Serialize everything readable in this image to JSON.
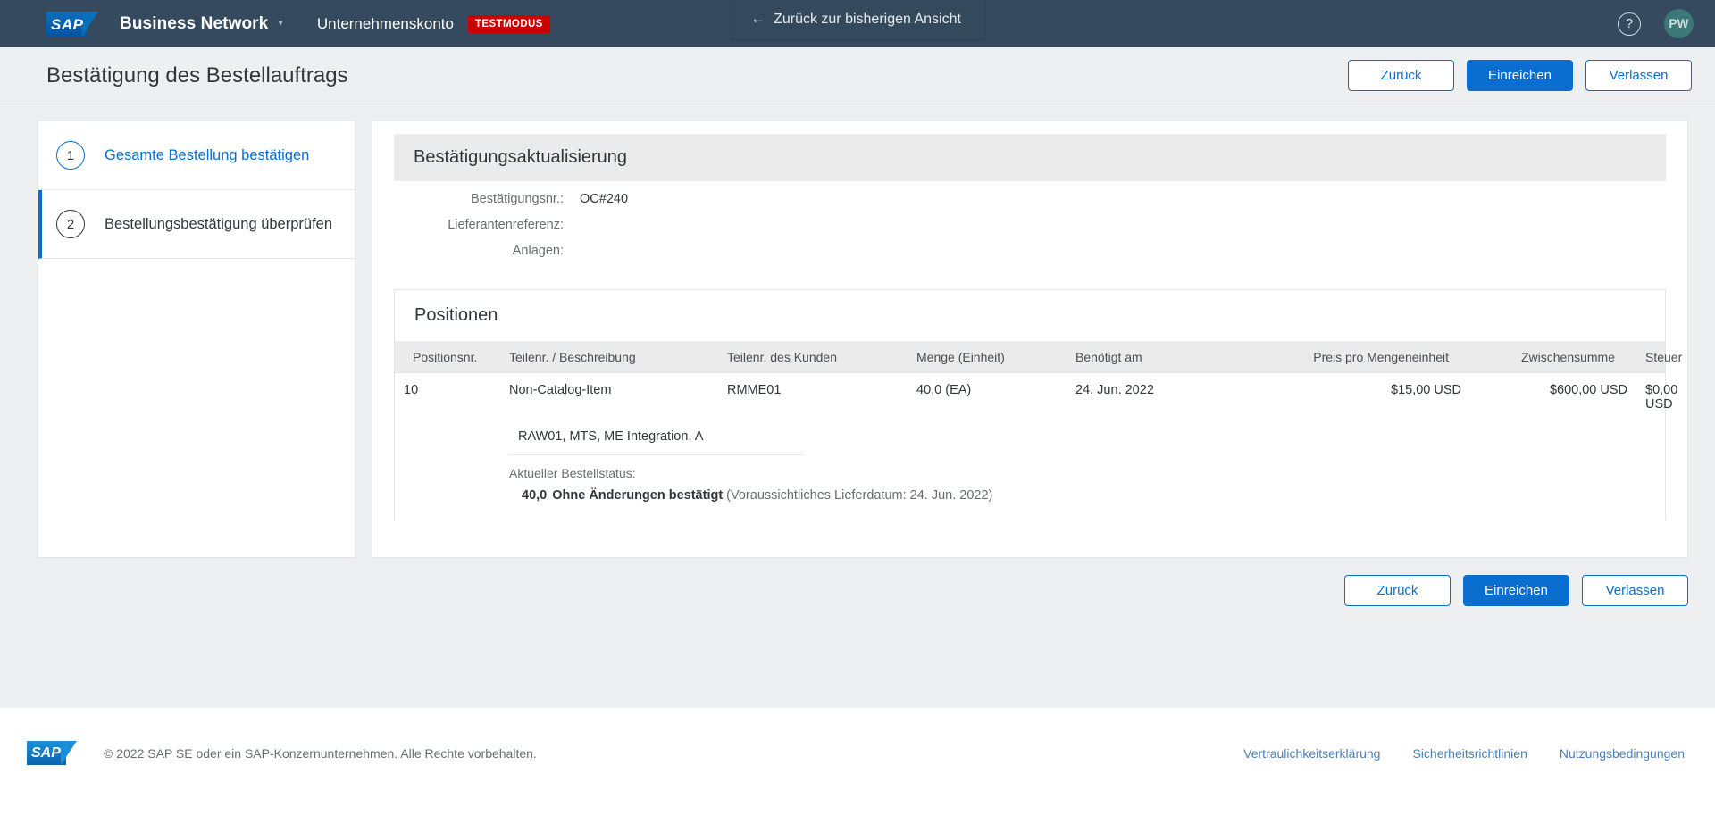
{
  "header": {
    "logo_text": "SAP",
    "brand": "Business Network",
    "brand_caret_icon": "chevron-down-icon",
    "account": "Unternehmenskonto",
    "test_mode_badge": "TESTMODUS",
    "back_pill": {
      "arrow_icon": "arrow-left-icon",
      "label": "Zurück zur bisherigen Ansicht"
    },
    "help_icon_glyph": "?",
    "avatar_initials": "PW",
    "bar_color": "#354a5f",
    "badge_color": "#cc0000"
  },
  "page": {
    "title": "Bestätigung des Bestellauftrags"
  },
  "actions": {
    "back": "Zurück",
    "submit": "Einreichen",
    "exit": "Verlassen",
    "primary_color": "#0a6ed1"
  },
  "sidebar": {
    "steps": [
      {
        "number": "1",
        "label": "Gesamte Bestellung bestätigen",
        "active": false
      },
      {
        "number": "2",
        "label": "Bestellungsbestätigung überprüfen",
        "active": true
      }
    ]
  },
  "confirmation": {
    "section_title": "Bestätigungsaktualisierung",
    "fields": [
      {
        "label": "Bestätigungsnr.:",
        "value": "OC#240"
      },
      {
        "label": "Lieferantenreferenz:",
        "value": ""
      },
      {
        "label": "Anlagen:",
        "value": ""
      }
    ]
  },
  "items": {
    "title": "Positionen",
    "columns": [
      "Positionsnr.",
      "Teilenr. / Beschreibung",
      "Teilenr. des Kunden",
      "Menge (Einheit)",
      "Benötigt am",
      "Preis pro Mengeneinheit",
      "Zwischensumme",
      "Steuer"
    ],
    "rows": [
      {
        "position": "10",
        "part": "Non-Catalog-Item",
        "description": "RAW01, MTS, ME Integration, A",
        "customer_part": "RMME01",
        "quantity": "40,0 (EA)",
        "needed_on": "24. Jun. 2022",
        "unit_price": "$15,00 USD",
        "subtotal": "$600,00 USD",
        "tax": "$0,00 USD",
        "status_label": "Aktueller Bestellstatus:",
        "status_qty": "40,0",
        "status_state": "Ohne Änderungen bestätigt",
        "status_note": "(Voraussichtliches Lieferdatum: 24. Jun. 2022)"
      }
    ]
  },
  "footer": {
    "logo_text": "SAP",
    "copyright": "© 2022 SAP SE oder ein SAP-Konzernunternehmen. Alle Rechte vorbehalten.",
    "links": [
      "Vertraulichkeitserklärung",
      "Sicherheitsrichtlinien",
      "Nutzungsbedingungen"
    ]
  }
}
